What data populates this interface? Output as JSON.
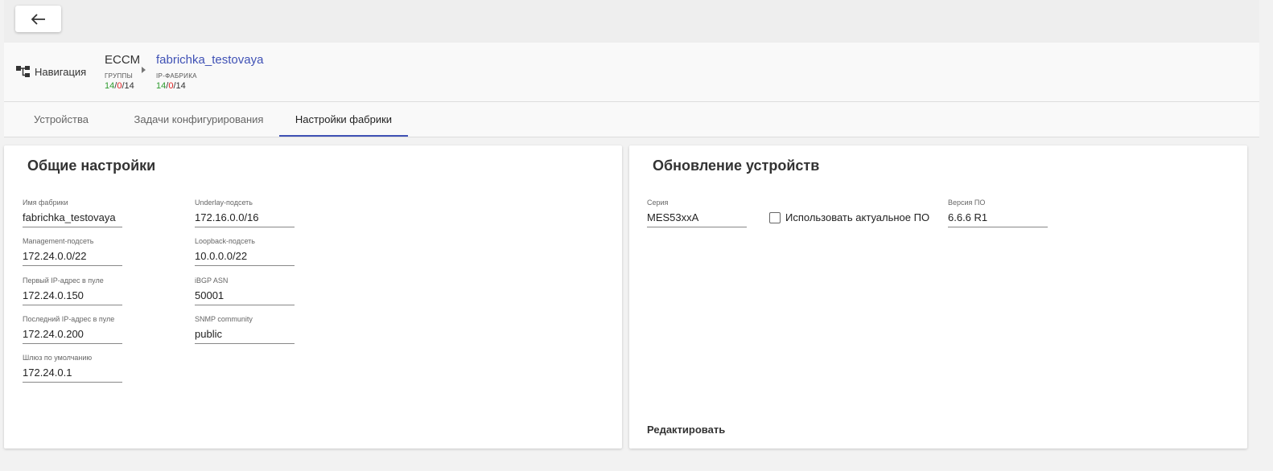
{
  "header": {
    "back_icon": "arrow-left-icon",
    "navigation_label": "Навигация",
    "navigation_icon": "tree-icon"
  },
  "breadcrumb": [
    {
      "title": "ECCM",
      "subtitle": "группы",
      "ok": "14",
      "err": "0",
      "total": "14"
    },
    {
      "title": "fabrichka_testovaya",
      "subtitle": "IP-фабрика",
      "ok": "14",
      "err": "0",
      "total": "14"
    }
  ],
  "tabs": [
    {
      "label": "Устройства",
      "active": false
    },
    {
      "label": "Задачи конфигурирования",
      "active": false
    },
    {
      "label": "Настройки фабрики",
      "active": true
    }
  ],
  "general": {
    "title": "Общие настройки",
    "fields": [
      {
        "label": "Имя фабрики",
        "value": "fabrichka_testovaya"
      },
      {
        "label": "Underlay-подсеть",
        "value": "172.16.0.0/16"
      },
      {
        "label": "Management-подсеть",
        "value": "172.24.0.0/22"
      },
      {
        "label": "Loopback-подсеть",
        "value": "10.0.0.0/22"
      },
      {
        "label": "Первый IP-адрес в пуле",
        "value": "172.24.0.150"
      },
      {
        "label": "iBGP ASN",
        "value": "50001"
      },
      {
        "label": "Последний IP-адрес в пуле",
        "value": "172.24.0.200"
      },
      {
        "label": "SNMP community",
        "value": "public"
      },
      {
        "label": "Шлюз по умолчанию",
        "value": "172.24.0.1"
      }
    ]
  },
  "update": {
    "title": "Обновление устройств",
    "series_label": "Серия",
    "series_value": "MES53xxA",
    "checkbox_label": "Использовать актуальное ПО",
    "checkbox_checked": false,
    "version_label": "Версия ПО",
    "version_value": "6.6.6 R1",
    "edit_label": "Редактировать"
  },
  "colors": {
    "accent": "#3f51b5",
    "ok": "#2e9b2e",
    "error": "#e02020"
  }
}
